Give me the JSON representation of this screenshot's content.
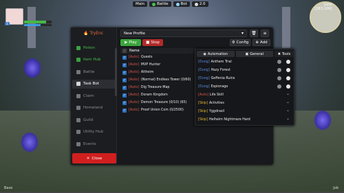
{
  "hud": {
    "main": "Main",
    "battle": "Battle",
    "bot": "Bot",
    "version": "2.0"
  },
  "player": {
    "level": "3",
    "hp_pct": 0.8,
    "mp_pct": 0.6
  },
  "minimap": {
    "zone": "Juno",
    "coords": "[163,109]"
  },
  "bottom": {
    "left": "Base",
    "right": "Job"
  },
  "sidebar": {
    "brand": "TryEnc",
    "items": [
      {
        "label": "Potion",
        "style": "green"
      },
      {
        "label": "Item Hub",
        "style": "green"
      },
      {
        "label": "Battle",
        "style": "dim"
      },
      {
        "label": "Task Bot",
        "style": "active"
      },
      {
        "label": "Claim",
        "style": "dim"
      },
      {
        "label": "Homeland",
        "style": "dim"
      },
      {
        "label": "Guild",
        "style": "dim"
      },
      {
        "label": "Utility Hub",
        "style": "dim"
      },
      {
        "label": "Events",
        "style": "dim"
      }
    ],
    "close_label": "Close"
  },
  "profile": {
    "value": "New Profile"
  },
  "toolbar": {
    "play": "Play",
    "stop": "Stop",
    "config": "Config",
    "add": "Add"
  },
  "tasks": {
    "header": "Name",
    "rows": [
      {
        "tag": "[Auto]",
        "name": "Quests"
      },
      {
        "tag": "[Auto]",
        "name": "MVP Hunter"
      },
      {
        "tag": "[Auto]",
        "name": "Altheim"
      },
      {
        "tag": "[Auto]",
        "name": "(Normal) Endless Tower (0/60)"
      },
      {
        "tag": "[Auto]",
        "name": "Dig Treasure Map"
      },
      {
        "tag": "[Auto]",
        "name": "Doram Kingdom"
      },
      {
        "tag": "[Auto]",
        "name": "Demon Treasure (0/10) (65)"
      },
      {
        "tag": "[Auto]",
        "name": "Proof Union Coin (0/2500)"
      }
    ]
  },
  "popup": {
    "tabs": [
      "Automation",
      "General",
      "Tools"
    ],
    "rows": [
      {
        "tag": "[Dung]",
        "type": "dung",
        "name": "Anthem Trial"
      },
      {
        "tag": "[Dung]",
        "type": "dung",
        "name": "Hazy Forest"
      },
      {
        "tag": "[Dung]",
        "type": "dung",
        "name": "Geffenia Ruins"
      },
      {
        "tag": "[Dung]",
        "type": "dung",
        "name": "Espionage"
      },
      {
        "tag": "[Auto]",
        "type": "auto",
        "name": "Life Skill"
      },
      {
        "tag": "[Skip]",
        "type": "skip",
        "name": "Activities"
      },
      {
        "tag": "[Skip]",
        "type": "skip",
        "name": "Yggdrasil"
      },
      {
        "tag": "[Skip]",
        "type": "skip",
        "name": "Helheim Nightmare Hard"
      }
    ]
  },
  "colors": {
    "accent_green": "#3ca63c",
    "stop_red": "#b32a2a",
    "close_red": "#d11f1f",
    "dung_blue": "#5a8de0",
    "skip_yellow": "#e8b83a",
    "auto_red": "#e0584b"
  }
}
